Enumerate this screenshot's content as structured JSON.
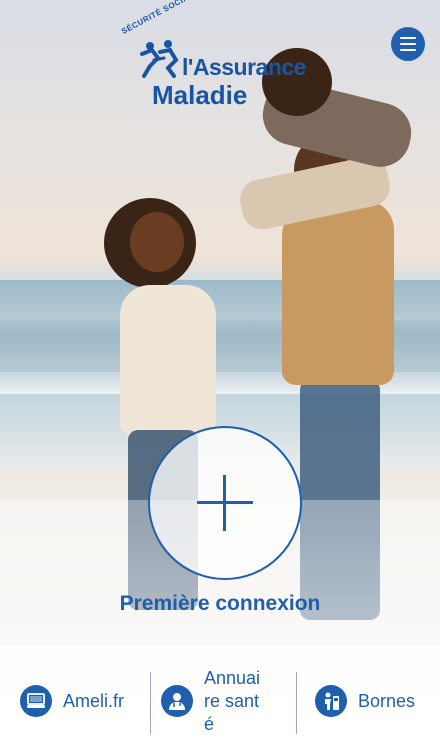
{
  "logo": {
    "top_text": "SÉCURITÉ SOCIALE",
    "title": "l'Assurance",
    "subtitle": "Maladie"
  },
  "header": {
    "menu_icon": "menu-icon"
  },
  "main": {
    "plus_icon": "plus-icon",
    "first_login_label": "Première connexion"
  },
  "bottom_nav": {
    "items": [
      {
        "label": "Ameli.fr",
        "icon": "computer-icon"
      },
      {
        "label": "Annuaire santé",
        "icon": "doctor-icon"
      },
      {
        "label": "Bornes",
        "icon": "kiosk-icon"
      }
    ]
  },
  "colors": {
    "brand_blue": "#1f5fad",
    "divider": "#9aa9bd"
  }
}
